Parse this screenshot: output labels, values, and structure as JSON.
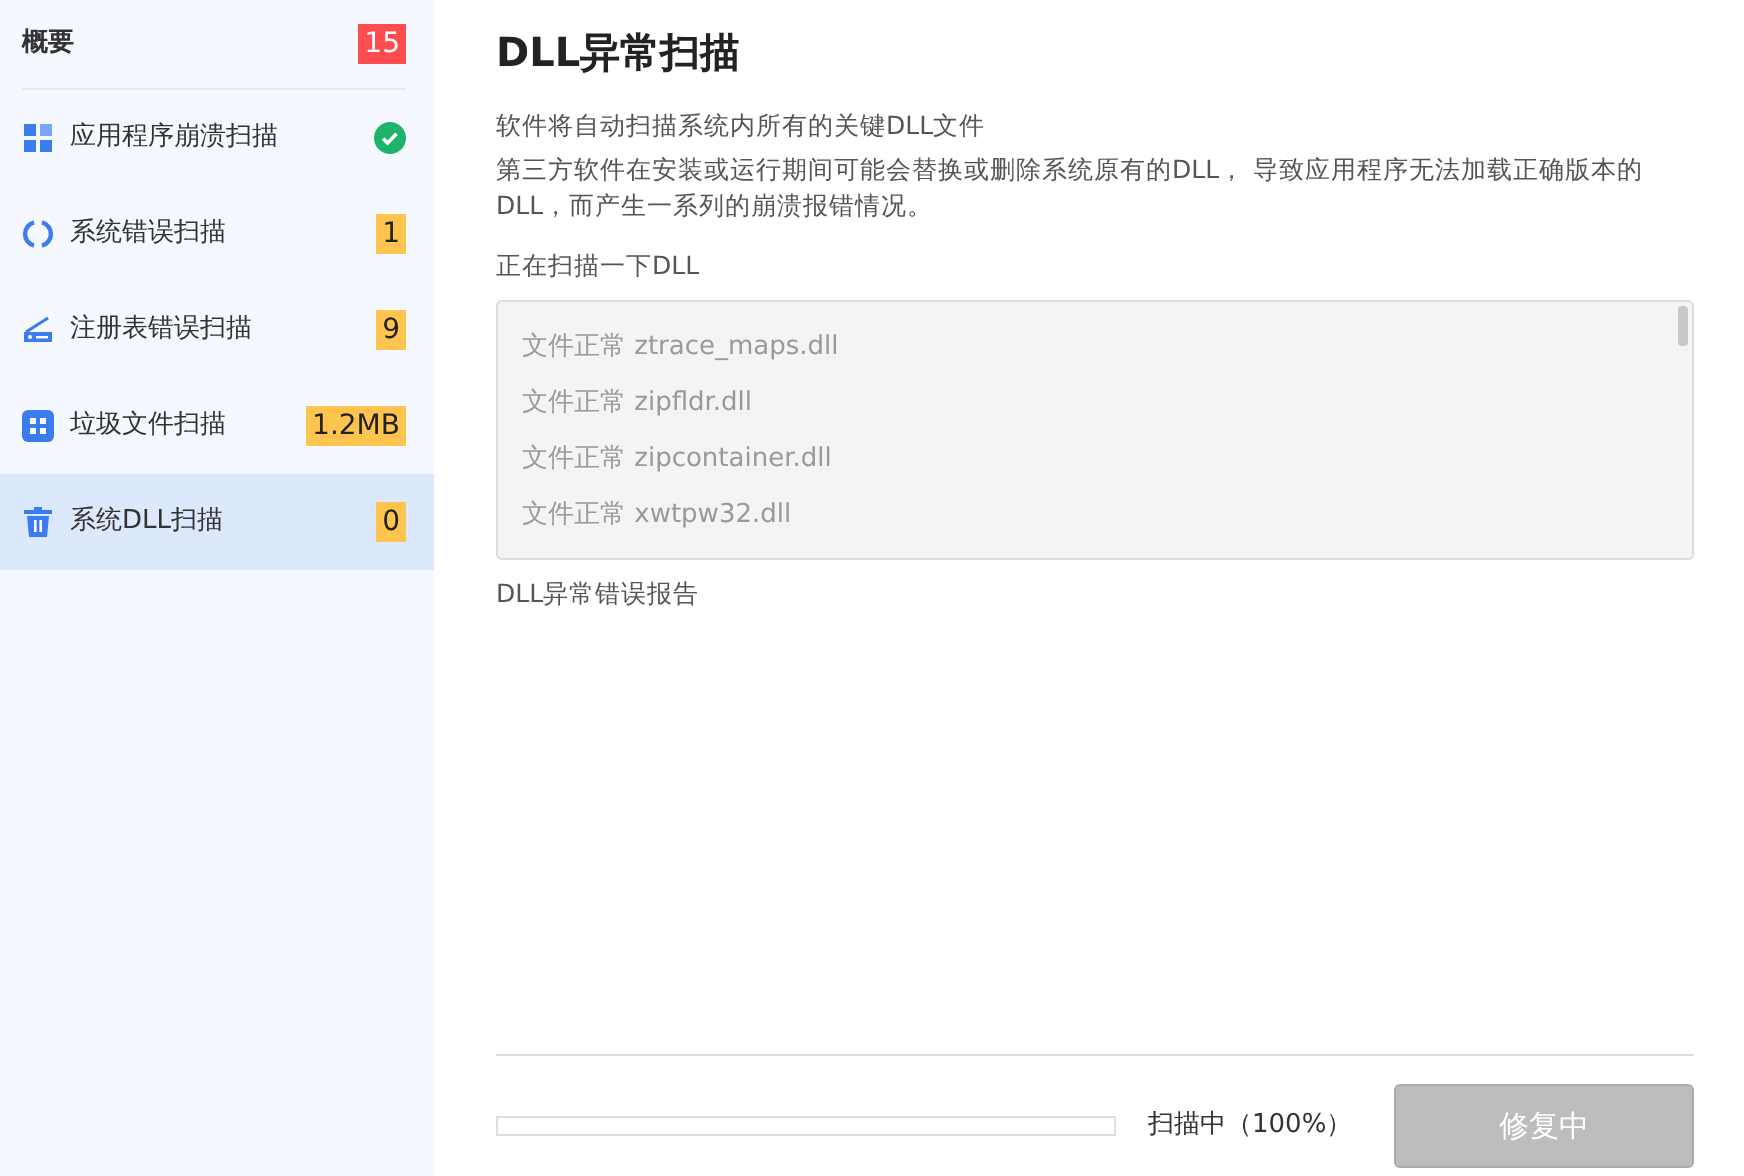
{
  "sidebar": {
    "header": {
      "label": "概要",
      "badge": "15",
      "color": "#ff4d4f"
    },
    "items": [
      {
        "label": "应用程序崩溃扫描",
        "kind": "check",
        "selected": false
      },
      {
        "label": "系统错误扫描",
        "kind": "badge",
        "badge": "1",
        "color": "#ffc44d",
        "selected": false
      },
      {
        "label": "注册表错误扫描",
        "kind": "badge",
        "badge": "9",
        "color": "#ffc44d",
        "selected": false
      },
      {
        "label": "垃圾文件扫描",
        "kind": "badge",
        "badge": "1.2MB",
        "color": "#ffc44d",
        "selected": false
      },
      {
        "label": "系统DLL扫描",
        "kind": "badge",
        "badge": "0",
        "color": "#ffc44d",
        "selected": true
      }
    ]
  },
  "main": {
    "title": "DLL异常扫描",
    "description": [
      "软件将自动扫描系统内所有的关键DLL文件",
      "第三方软件在安装或运行期间可能会替换或删除系统原有的DLL， 导致应用程序无法加载正确版本的DLL，而产生一系列的崩溃报错情况。"
    ],
    "scan_label": "正在扫描一下DLL",
    "scan_log": [
      "文件正常 ztrace_maps.dll",
      "文件正常 zipfldr.dll",
      "文件正常 zipcontainer.dll",
      "文件正常 xwtpw32.dll"
    ],
    "report_label": "DLL异常错误报告",
    "progress": {
      "reading": "扫描中（100%）"
    },
    "button": {
      "label": "修复中",
      "disabled": true
    }
  }
}
